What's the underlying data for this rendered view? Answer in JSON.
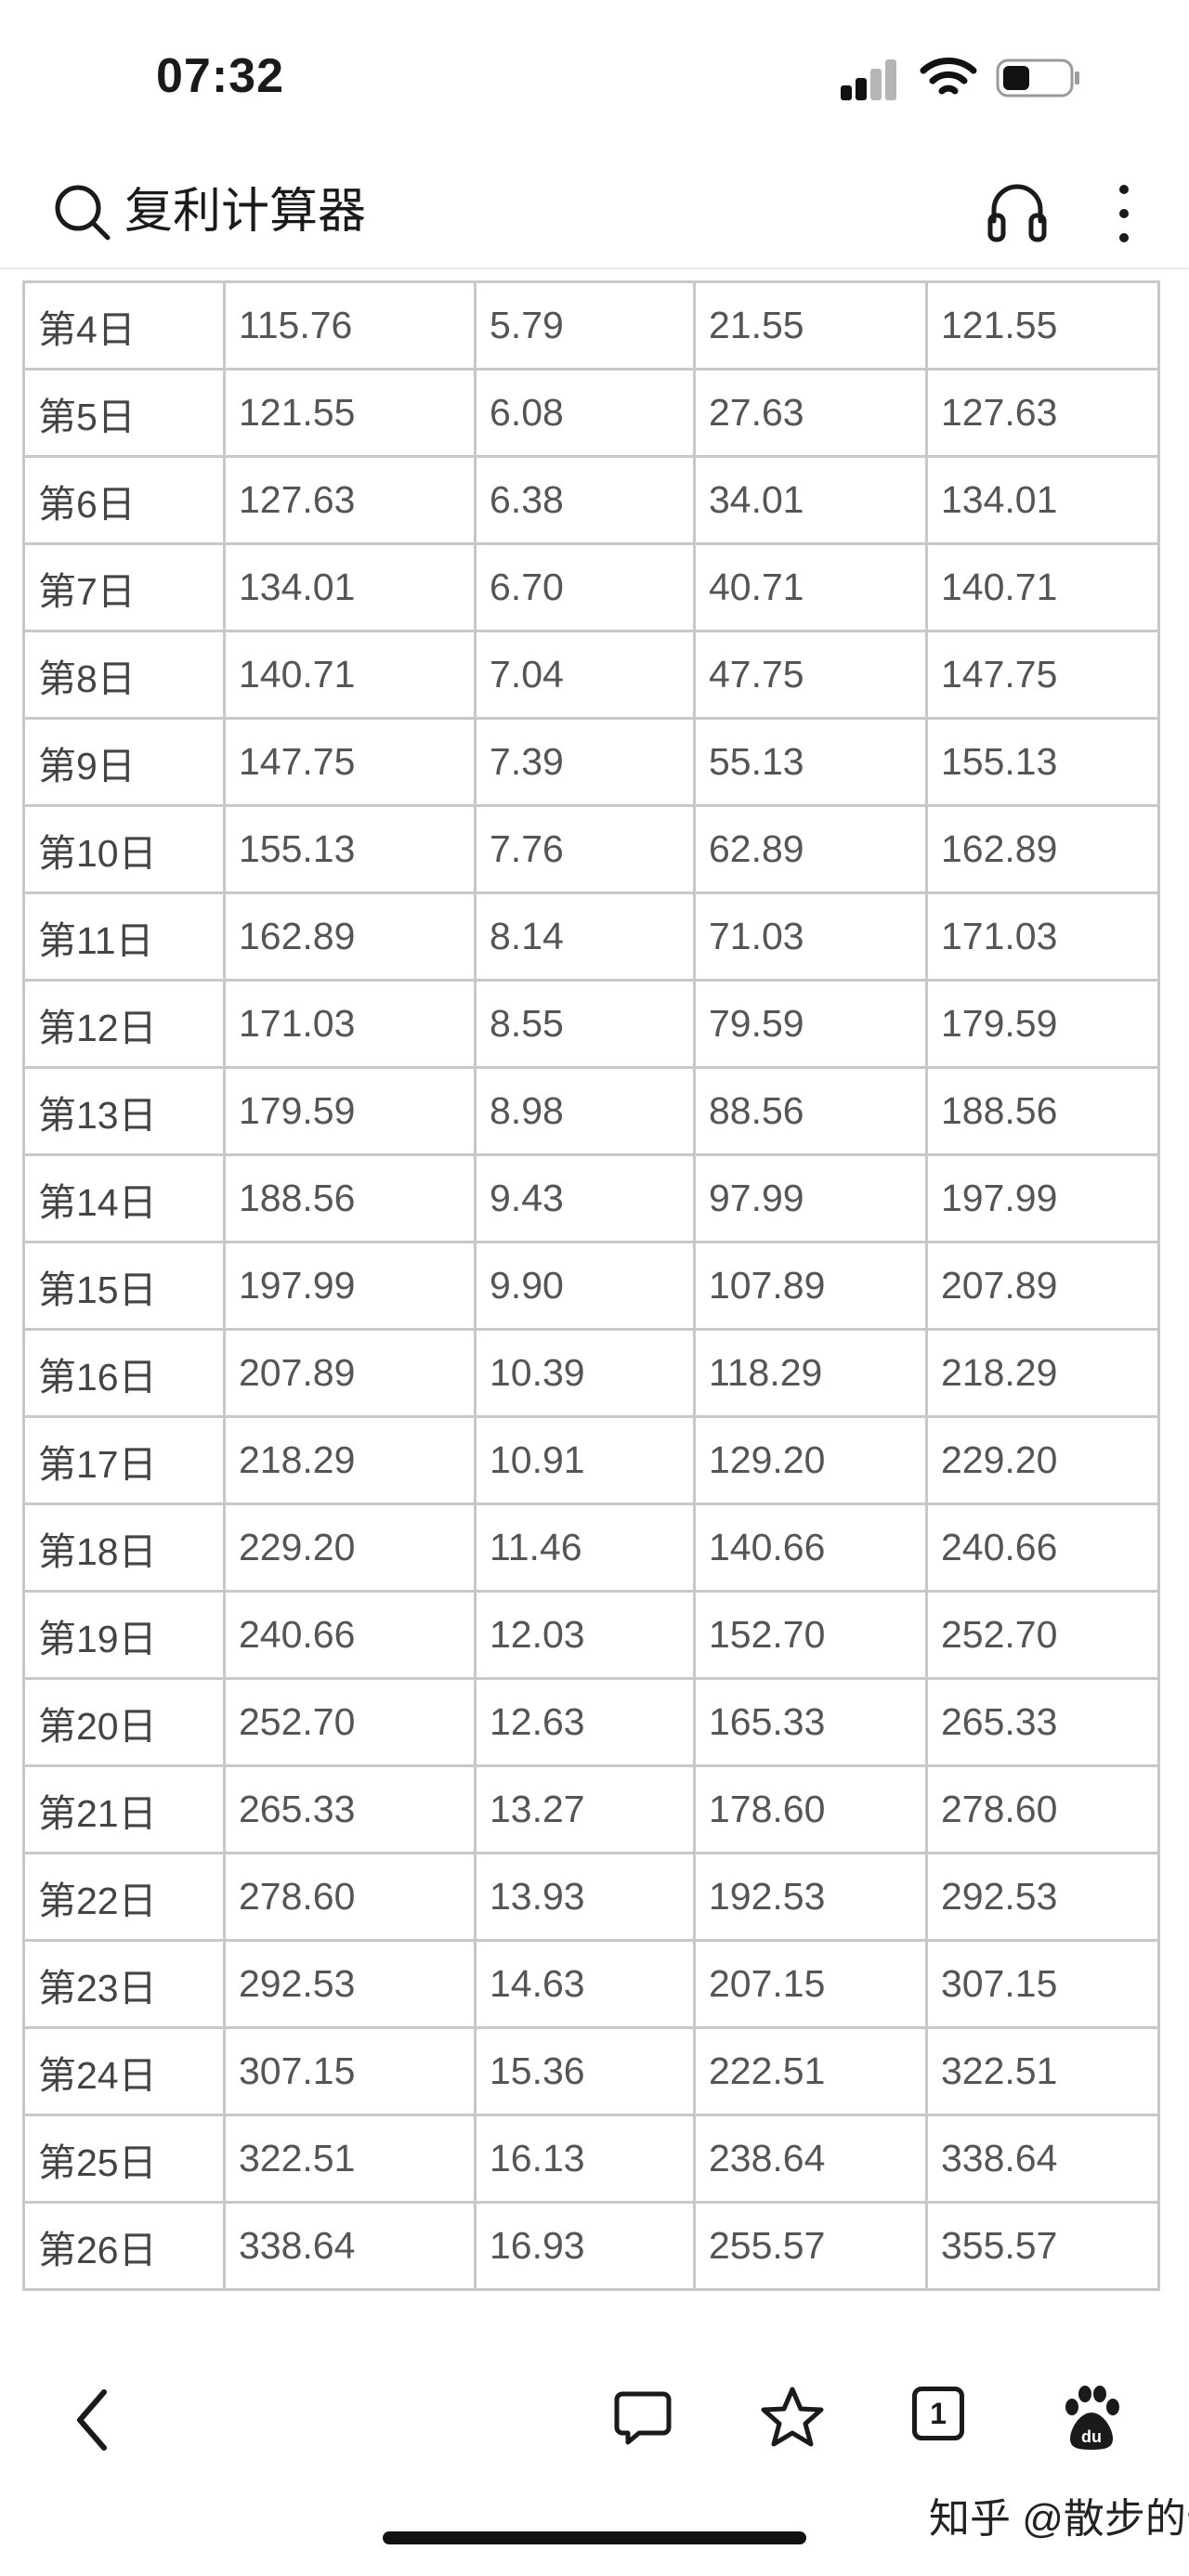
{
  "status_bar": {
    "time": "07:32",
    "signal_bars": 2,
    "battery_level": 0.3
  },
  "search": {
    "query": "复利计算器",
    "icons": [
      "search-icon",
      "headset-icon",
      "more-vertical-icon"
    ]
  },
  "table": {
    "rows": [
      [
        "第4日",
        "115.76",
        "5.79",
        "21.55",
        "121.55"
      ],
      [
        "第5日",
        "121.55",
        "6.08",
        "27.63",
        "127.63"
      ],
      [
        "第6日",
        "127.63",
        "6.38",
        "34.01",
        "134.01"
      ],
      [
        "第7日",
        "134.01",
        "6.70",
        "40.71",
        "140.71"
      ],
      [
        "第8日",
        "140.71",
        "7.04",
        "47.75",
        "147.75"
      ],
      [
        "第9日",
        "147.75",
        "7.39",
        "55.13",
        "155.13"
      ],
      [
        "第10日",
        "155.13",
        "7.76",
        "62.89",
        "162.89"
      ],
      [
        "第11日",
        "162.89",
        "8.14",
        "71.03",
        "171.03"
      ],
      [
        "第12日",
        "171.03",
        "8.55",
        "79.59",
        "179.59"
      ],
      [
        "第13日",
        "179.59",
        "8.98",
        "88.56",
        "188.56"
      ],
      [
        "第14日",
        "188.56",
        "9.43",
        "97.99",
        "197.99"
      ],
      [
        "第15日",
        "197.99",
        "9.90",
        "107.89",
        "207.89"
      ],
      [
        "第16日",
        "207.89",
        "10.39",
        "118.29",
        "218.29"
      ],
      [
        "第17日",
        "218.29",
        "10.91",
        "129.20",
        "229.20"
      ],
      [
        "第18日",
        "229.20",
        "11.46",
        "140.66",
        "240.66"
      ],
      [
        "第19日",
        "240.66",
        "12.03",
        "152.70",
        "252.70"
      ],
      [
        "第20日",
        "252.70",
        "12.63",
        "165.33",
        "265.33"
      ],
      [
        "第21日",
        "265.33",
        "13.27",
        "178.60",
        "278.60"
      ],
      [
        "第22日",
        "278.60",
        "13.93",
        "192.53",
        "292.53"
      ],
      [
        "第23日",
        "292.53",
        "14.63",
        "207.15",
        "307.15"
      ],
      [
        "第24日",
        "307.15",
        "15.36",
        "222.51",
        "322.51"
      ],
      [
        "第25日",
        "322.51",
        "16.13",
        "238.64",
        "338.64"
      ],
      [
        "第26日",
        "338.64",
        "16.93",
        "255.57",
        "355.57"
      ]
    ]
  },
  "toolbar": {
    "tab_count": "1",
    "icons": [
      "back-icon",
      "comment-icon",
      "star-icon",
      "tabs-icon",
      "baidu-paw-icon"
    ]
  },
  "watermark": "知乎 @散步的云"
}
